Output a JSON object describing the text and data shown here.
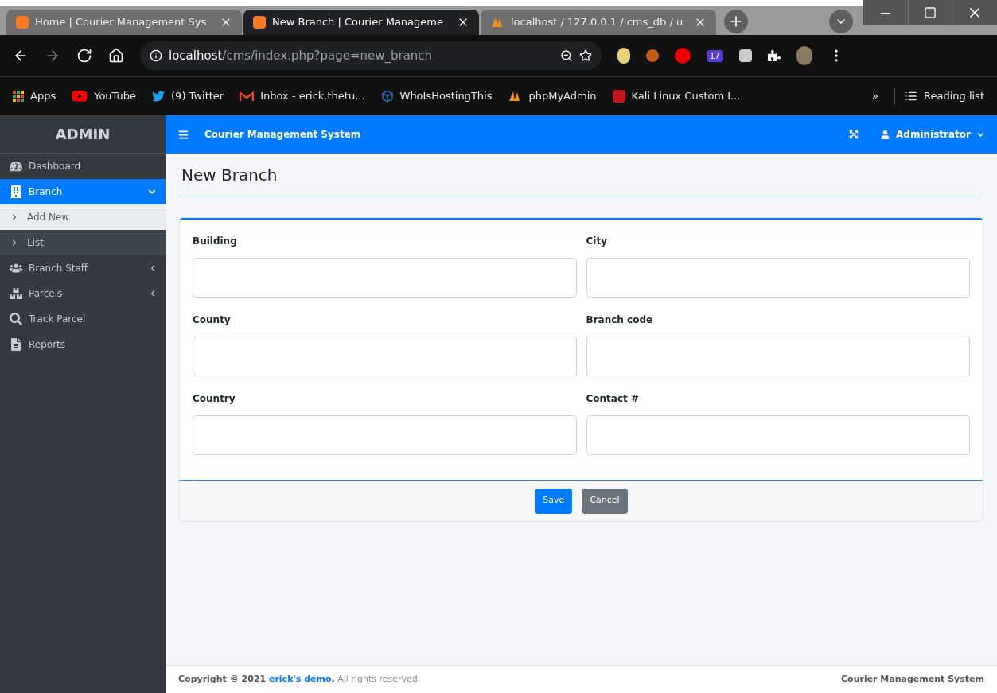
{
  "browser": {
    "tabs": [
      {
        "title": "Home | Courier Management Sys",
        "kind": "xampp",
        "selected": false
      },
      {
        "title": "New Branch | Courier Manageme",
        "kind": "xampp",
        "selected": true
      },
      {
        "title": "localhost / 127.0.0.1 / cms_db / u",
        "kind": "pma",
        "selected": false
      }
    ],
    "url_host": "localhost",
    "url_path": "/cms/index.php?page=new_branch",
    "extension_badge": "17",
    "bookmarks": [
      {
        "label": "Apps",
        "kind": "apps"
      },
      {
        "label": "YouTube",
        "kind": "youtube"
      },
      {
        "label": "(9) Twitter",
        "kind": "twitter"
      },
      {
        "label": "Inbox - erick.thetu...",
        "kind": "gmail"
      },
      {
        "label": "WhoIsHostingThis",
        "kind": "cube"
      },
      {
        "label": "phpMyAdmin",
        "kind": "pma"
      },
      {
        "label": "Kali Linux Custom I...",
        "kind": "kali"
      }
    ],
    "overflow": "»",
    "reading_list": "Reading list"
  },
  "sidebar": {
    "brand": "ADMIN",
    "items": [
      {
        "label": "Dashboard",
        "kind": "gauge",
        "selected": false
      },
      {
        "label": "Branch",
        "kind": "building",
        "selected": true,
        "expanded": true,
        "children": [
          {
            "label": "Add New",
            "selected": true
          },
          {
            "label": "List",
            "selected": false
          }
        ]
      },
      {
        "label": "Branch Staff",
        "kind": "users",
        "selected": false,
        "expanded": false
      },
      {
        "label": "Parcels",
        "kind": "boxes",
        "selected": false,
        "expanded": false
      },
      {
        "label": "Track Parcel",
        "kind": "search",
        "selected": false
      },
      {
        "label": "Reports",
        "kind": "file",
        "selected": false
      }
    ]
  },
  "topbar": {
    "title": "Courier Management System",
    "user": "Administrator"
  },
  "page_title": "New Branch",
  "form": {
    "fields": [
      {
        "label": "Building"
      },
      {
        "label": "City"
      },
      {
        "label": "County"
      },
      {
        "label": "Branch code"
      },
      {
        "label": "Country"
      },
      {
        "label": "Contact #"
      }
    ],
    "buttons": [
      {
        "label": "Save",
        "kind": "primary"
      },
      {
        "label": "Cancel",
        "kind": "secondary"
      }
    ]
  },
  "footer": {
    "prefix": "Copyright © 2021",
    "link": "erick's demo.",
    "suffix": "All rights reserved.",
    "right": "Courier Management System"
  }
}
